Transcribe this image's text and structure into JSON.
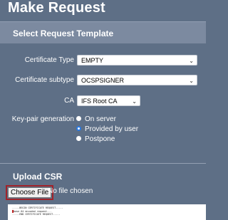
{
  "page": {
    "title": "Make Request"
  },
  "select_template": {
    "title": "Select Request Template",
    "certificate_type": {
      "label": "Certificate Type",
      "value": "EMPTY"
    },
    "certificate_subtype": {
      "label": "Certificate subtype",
      "value": "OCSPSIGNER"
    },
    "ca": {
      "label": "CA",
      "value": "IFS Root CA"
    },
    "keypair": {
      "label": "Key-pair generation",
      "options": [
        "On server",
        "Provided by user",
        "Postpone"
      ],
      "selected": "Provided by user"
    }
  },
  "upload_csr": {
    "title": "Upload CSR",
    "button_label": "Choose File",
    "status": "No file chosen",
    "csr_lines": [
      "-----BEGIN CERTIFICATE REQUEST-----",
      "base 64 encoded request...",
      "-----END CERTIFICATE REQUEST-----"
    ]
  },
  "colors": {
    "background": "#5e6f86",
    "section_band": "#7c8aa0",
    "selected_radio": "#2d7be0",
    "focus_outline": "#a1232a"
  },
  "icons": {
    "dropdown": "chevron-down-icon",
    "radio_selected": "radio-selected-icon",
    "radio_unselected": "radio-unselected-icon"
  }
}
